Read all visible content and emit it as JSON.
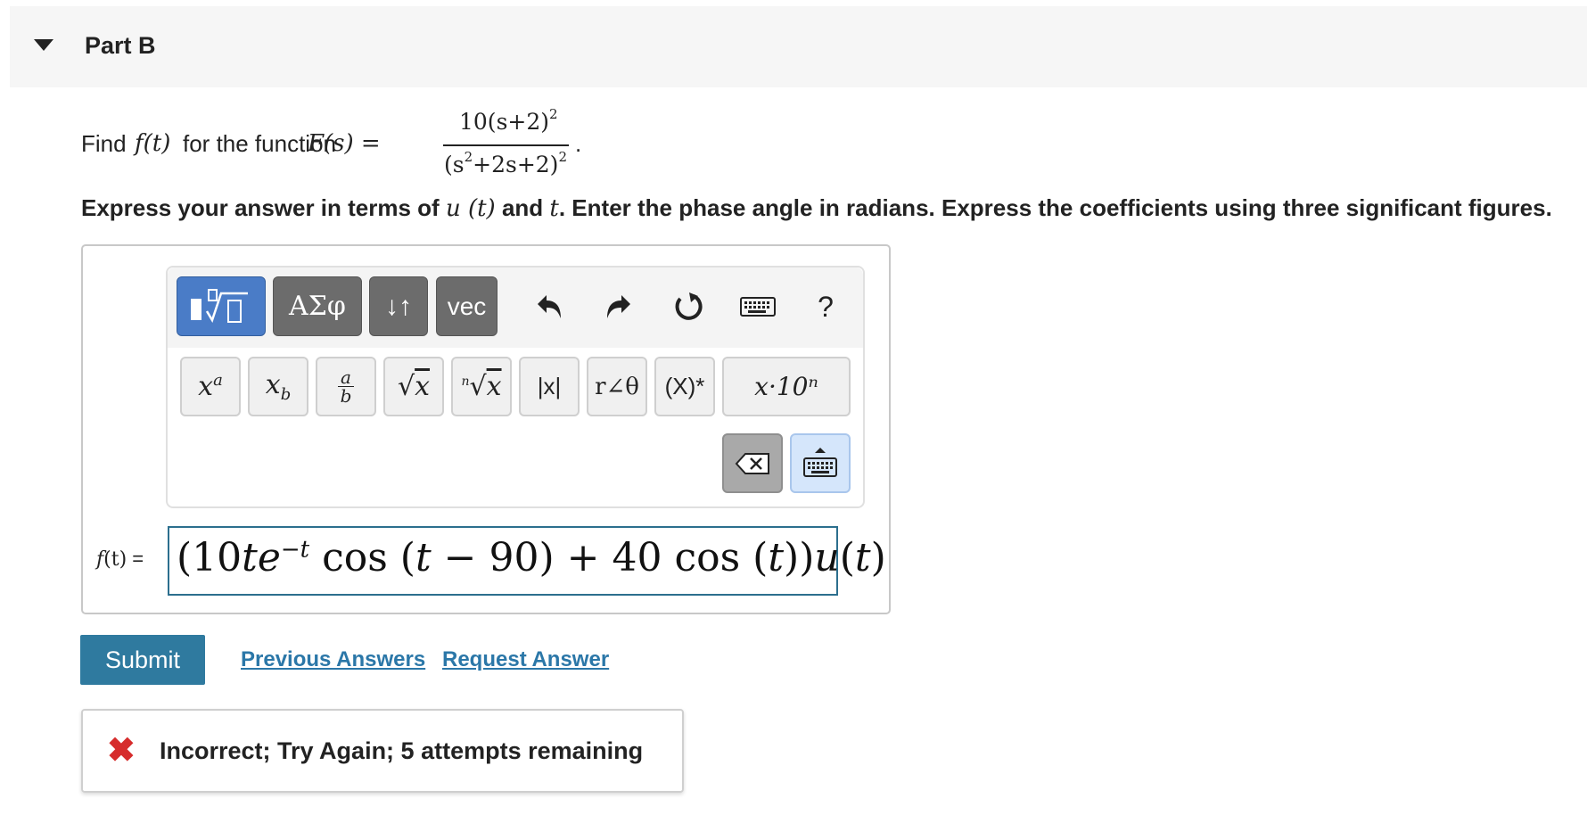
{
  "part": {
    "title": "Part B"
  },
  "question": {
    "find_text": "Find",
    "for_text": "for the function",
    "f_of_t": "f(t)",
    "F_of_s": "F(s) =",
    "numerator": "10(s+2)",
    "num_exp": "2",
    "denominator": "(s",
    "den_exp1": "2",
    "den_rest": "+2s+2)",
    "den_exp2": "2",
    "period": "."
  },
  "instruction": {
    "prefix": "Express your answer in terms of",
    "u_t": "u (t)",
    "and_text": "and",
    "t_var": "t",
    "suffix": ". Enter the phase angle in radians. Express the coefficients using three significant figures."
  },
  "toolbar": {
    "greek_label": "ΑΣφ",
    "arrows_label": "↓↑",
    "vec_label": "vec",
    "help_label": "?",
    "abs_label": "|x|",
    "polar_label": "r∠θ",
    "conj_label": "(X)*",
    "sci_label": "x·10ⁿ"
  },
  "answer": {
    "label_f": "f",
    "label_t": "(t)",
    "label_eq": " =",
    "p1": "(10",
    "p2": "te",
    "p2_exp": "−t",
    "p3": " cos (",
    "p4": "t",
    "p5": " − 90) + 40 cos (",
    "p6": "t",
    "p7": "))",
    "p8": "u",
    "p9": "(",
    "p10": "t",
    "p11": ")"
  },
  "actions": {
    "submit_label": "Submit",
    "previous_answers_label": "Previous Answers",
    "request_answer_label": "Request Answer"
  },
  "feedback": {
    "message": "Incorrect; Try Again; 5 attempts remaining",
    "color": "#d62c2c"
  }
}
